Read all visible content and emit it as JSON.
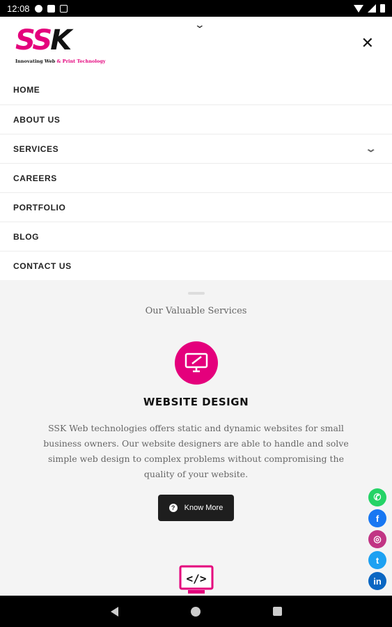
{
  "status_bar": {
    "time": "12:08"
  },
  "header": {
    "logo_letters_pink": "SS",
    "logo_letter_dark": "K",
    "logo_tagline_dark": "Innovating Web",
    "logo_tagline_pink": "& Print Technology",
    "close_symbol": "✕",
    "collapse_symbol": "⌄"
  },
  "nav": {
    "items": [
      {
        "label": "HOME"
      },
      {
        "label": "ABOUT US"
      },
      {
        "label": "SERVICES"
      },
      {
        "label": "CAREERS"
      },
      {
        "label": "PORTFOLIO"
      },
      {
        "label": "BLOG"
      },
      {
        "label": "CONTACT US"
      }
    ],
    "services_chevron": "⌄"
  },
  "services": {
    "section_title": "Our Valuable Services",
    "heading": "WEBSITE DESIGN",
    "description": "SSK Web technologies offers static and dynamic websites for small business owners. Our website designers are able to handle and solve simple web design to complex problems without compromising the quality of your website.",
    "button_label": "Know More",
    "button_icon": "?",
    "icon_name": "monitor-pen-icon",
    "next_icon_name": "code-monitor-icon"
  },
  "social": [
    {
      "name": "whatsapp",
      "glyph": "✆",
      "color": "#25d366"
    },
    {
      "name": "facebook",
      "glyph": "f",
      "color": "#1877f2"
    },
    {
      "name": "instagram",
      "glyph": "◎",
      "color": "#c13584"
    },
    {
      "name": "twitter",
      "glyph": "t",
      "color": "#1da1f2"
    },
    {
      "name": "linkedin",
      "glyph": "in",
      "color": "#0a66c2"
    }
  ],
  "colors": {
    "brand": "#e4007c",
    "dark_button": "#1e1e1e"
  }
}
